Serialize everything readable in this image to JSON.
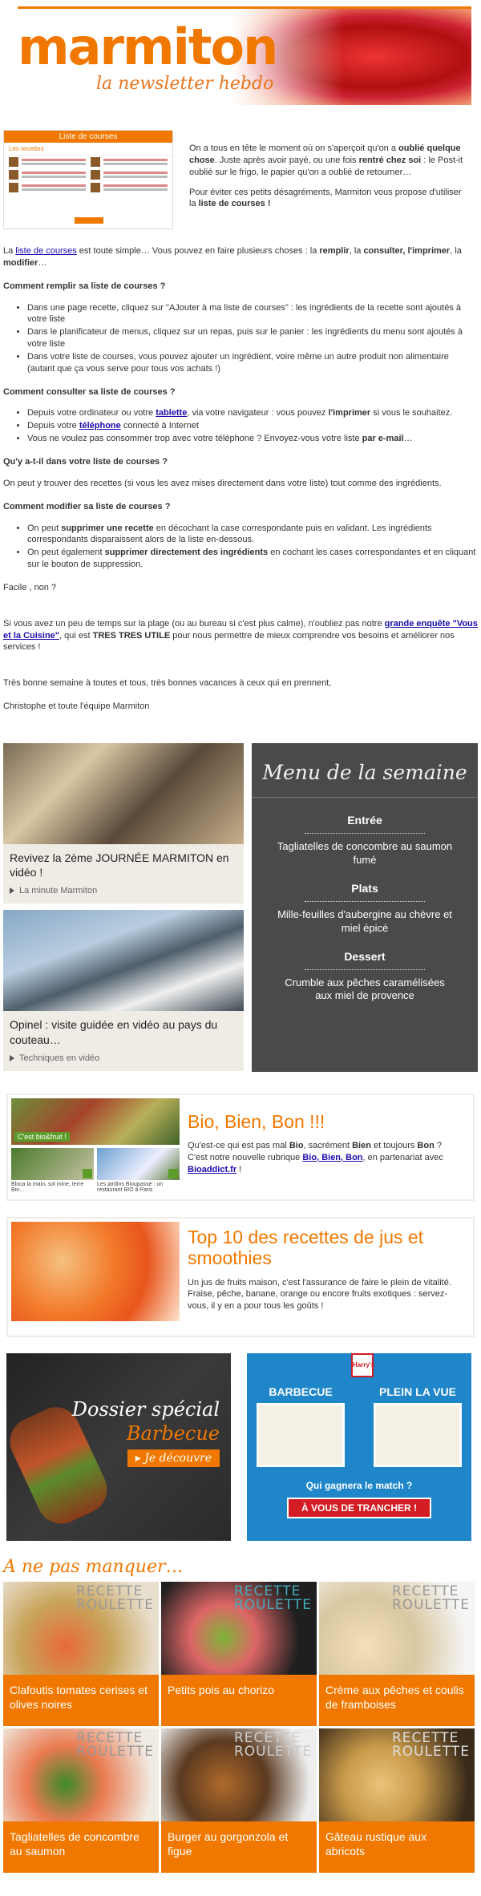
{
  "header": {
    "logo": "marmiton",
    "tagline": "la newsletter hebdo"
  },
  "list_thumb": {
    "title": "Liste de courses",
    "sub": "Les recettes"
  },
  "intro": {
    "p1_a": "On a tous en tête le moment où on s'aperçoit qu'on a ",
    "p1_b": "oublié quelque chose",
    "p1_c": ". Juste après avoir payé, ou une fois ",
    "p1_d": "rentré chez soi",
    "p1_e": " : le Post-it oublié sur le frigo, le papier qu'on a oublié de retourner…",
    "p2_a": "Pour éviter ces petits désagréments, Marmiton vous propose d'utiliser la ",
    "p2_b": "liste de courses !"
  },
  "body": {
    "p1_a": "La ",
    "p1_link": "liste de courses",
    "p1_b": " est toute simple… Vous pouvez en faire plusieurs choses : la ",
    "p1_c": "remplir",
    "p1_d": ", la ",
    "p1_e": "consulter, l'imprimer",
    "p1_f": ", la ",
    "p1_g": "modifier",
    "p1_h": "…",
    "h1": "Comment remplir sa liste de courses ?",
    "l1": [
      "Dans une page recette, cliquez sur \"AJouter à ma liste de courses\" : les ingrédients de la recette sont ajoutés à votre liste",
      "Dans le planificateur de menus, cliquez sur un repas, puis sur le panier : les ingrédients du menu sont ajoutés à votre liste",
      "Dans votre liste de courses, vous pouvez ajouter un ingrédient, voire même un autre produit non alimentaire (autant que ça vous serve pour tous vos achats !)"
    ],
    "h2": "Comment consulter sa liste de courses ?",
    "l2a_a": "Depuis votre ordinateur ou votre ",
    "l2a_link": "tablette",
    "l2a_b": ", via votre navigateur : vous pouvez ",
    "l2a_c": "l'imprimer",
    "l2a_d": " si vous le souhaitez.",
    "l2b_a": "Depuis votre ",
    "l2b_link": "téléphone",
    "l2b_b": " connecté à Internet",
    "l2c_a": "Vous ne voulez pas consommer trop avec votre téléphone ? Envoyez-vous votre liste ",
    "l2c_b": "par e-mail",
    "l2c_c": "…",
    "h3": "Qu'y a-t-il dans votre liste de courses ?",
    "p3": "On peut y trouver des recettes (si vous les avez mises directement dans votre liste) tout comme des ingrédients.",
    "h4": "Comment modifier sa liste de courses ?",
    "l4a_a": "On peut ",
    "l4a_b": "supprimer une recette",
    "l4a_c": " en décochant la case correspondante puis en validant. Les ingrédients correspondants disparaissent alors de la liste en-dessous.",
    "l4b_a": "On peut également ",
    "l4b_b": "supprimer directement des ingrédients",
    "l4b_c": " en cochant les cases correspondantes et en cliquant sur le bouton de suppression.",
    "p4": "Facile , non ?",
    "p5_a": "Si vous avez un peu de temps sur la plage (ou au bureau si c'est plus calme), n'oubliez pas notre ",
    "p5_link": "grande enquête \"Vous et la Cuisine\"",
    "p5_b": ", qui est ",
    "p5_c": "TRES TRES UTILE",
    "p5_d": " pour nous permettre de mieux comprendre vos besoins et améliorer nos services !",
    "p6": "Très bonne semaine à toutes et tous, très bonnes vacances à ceux qui en prennent,",
    "p7": "Christophe et toute l'équipe Marmiton"
  },
  "cards": [
    {
      "title": "Revivez la 2ème JOURNÉE MARMITON en vidéo !",
      "tag": "La minute Marmiton"
    },
    {
      "title": "Opinel : visite guidée en vidéo au pays du couteau…",
      "tag": "Techniques en vidéo"
    }
  ],
  "menu": {
    "title": "Menu de la semaine",
    "sections": [
      {
        "h": "Entrée",
        "text": "Tagliatelles de concombre au saumon fumé"
      },
      {
        "h": "Plats",
        "text": "Mille-feuilles d'aubergine au chèvre et miel épicé"
      },
      {
        "h": "Dessert",
        "text": "Crumble aux pêches caramélisées aux miel de provence"
      }
    ]
  },
  "bio": {
    "title": "Bio, Bien, Bon !!!",
    "badge": "C'est bio&fruit !",
    "cap1": "Bloca la main, sol mine, terre Bio…",
    "cap2": "Les jardins Bioupasse : un restaurant BIO à Paris",
    "t_a": "Qu'est-ce qui est pas mal ",
    "t_b": "Bio",
    "t_c": ", sacrément ",
    "t_d": "Bien",
    "t_e": " et toujours ",
    "t_f": "Bon",
    "t_g": " ?",
    "t_h": "C'est notre nouvelle rubrique ",
    "t_link1": "Bio, Bien, Bon",
    "t_i": ", en partenariat avec ",
    "t_link2": "Bioaddict.fr",
    "t_j": " !"
  },
  "smoothies": {
    "title": "Top 10 des recettes de jus et smoothies",
    "text1": "Un jus de fruits maison, c'est l'assurance de faire le plein de vitalité.",
    "text2": "Fraise, pêche, banane, orange ou encore fruits exotiques : servez-vous, il y en a pour tous les goûts !"
  },
  "bbq": {
    "t1": "Dossier spécial",
    "t2": "Barbecue",
    "cta": "Je découvre"
  },
  "harrys": {
    "logo": "Harry's",
    "c1": "BARBECUE",
    "c2": "PLEIN LA VUE",
    "q": "Qui gagnera le match ?",
    "cta": "À VOUS DE TRANCHER !"
  },
  "npm": {
    "title": "A ne pas manquer…",
    "rr1": "RECETTE",
    "rr2": "ROULETTE",
    "items": [
      "Clafoutis tomates cerises et olives noires",
      "Petits pois au chorizo",
      "Crème aux pêches et coulis de framboises",
      "Tagliatelles de concombre au saumon",
      "Burger au gorgonzola et figue",
      "Gâteau rustique aux abricots"
    ]
  }
}
